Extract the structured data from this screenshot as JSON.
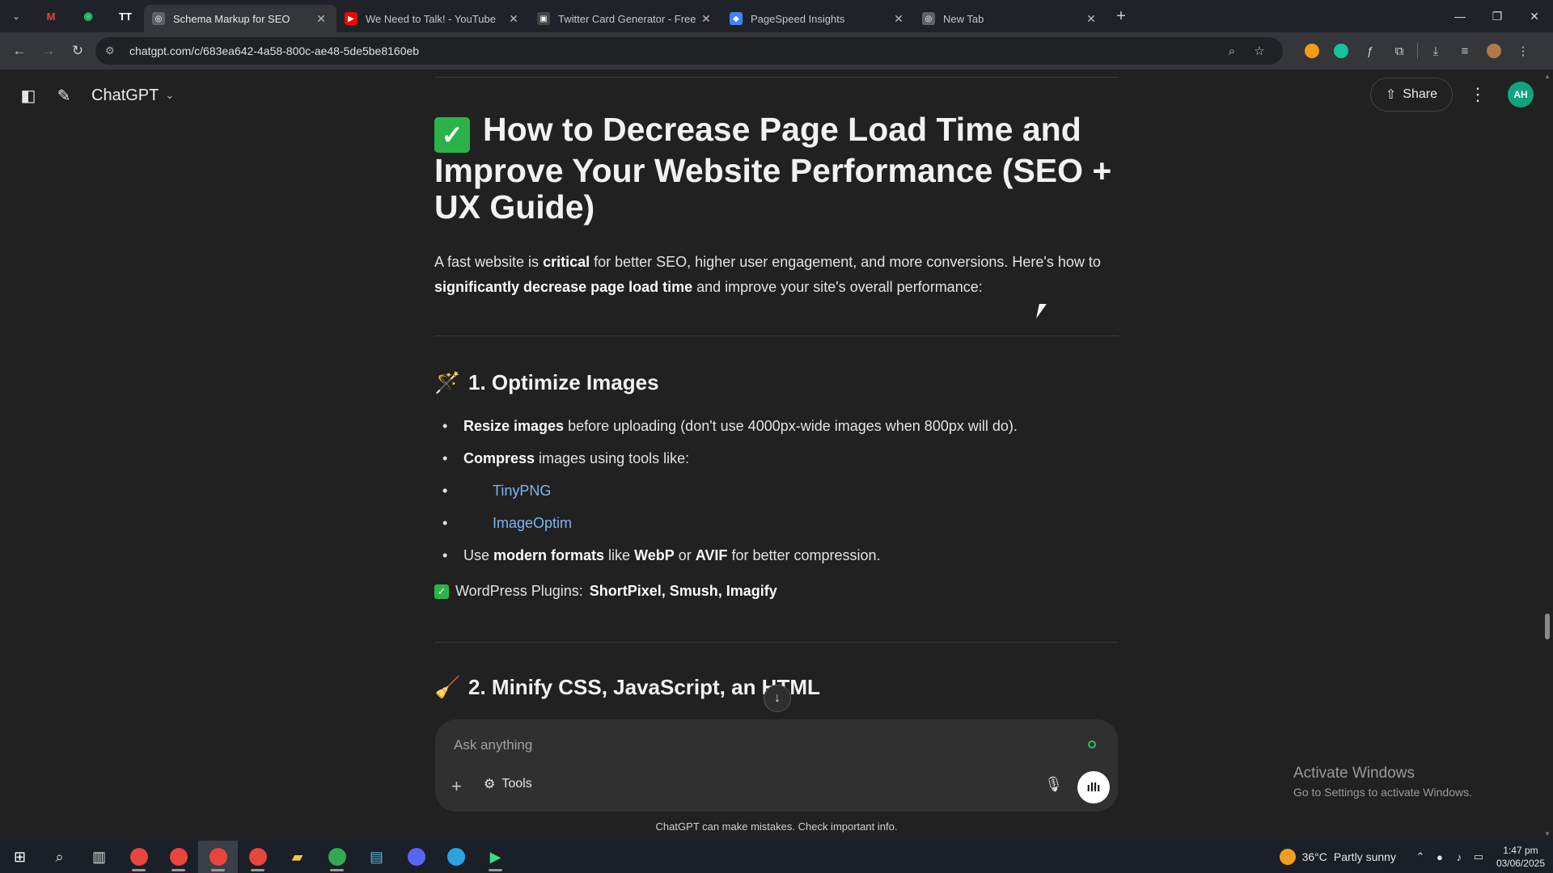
{
  "browser": {
    "pinned": [
      {
        "name": "gmail-icon",
        "glyph": "M",
        "color": "#ea4335"
      },
      {
        "name": "whatsapp-icon",
        "glyph": "◉",
        "color": "#25d366"
      },
      {
        "name": "tt-icon",
        "glyph": "TT",
        "color": "#ffffff"
      }
    ],
    "tabs": [
      {
        "title": "Schema Markup for SEO",
        "active": true,
        "fav": "◎",
        "favcolor": "#5f6368"
      },
      {
        "title": "We Need to Talk! - YouTube",
        "active": false,
        "fav": "▶",
        "favcolor": "#ff0000"
      },
      {
        "title": "Twitter Card Generator - Free T",
        "active": false,
        "fav": "▣",
        "favcolor": "#444"
      },
      {
        "title": "PageSpeed Insights",
        "active": false,
        "fav": "◆",
        "favcolor": "#4285f4"
      },
      {
        "title": "New Tab",
        "active": false,
        "fav": "◎",
        "favcolor": "#5f6368"
      }
    ],
    "url": "chatgpt.com/c/683ea642-4a58-800c-ae48-5de5be8160eb"
  },
  "app": {
    "model_label": "ChatGPT",
    "share_label": "Share",
    "avatar_initials": "AH"
  },
  "article": {
    "title": "How to Decrease Page Load Time and Improve Your Website Performance (SEO + UX Guide)",
    "intro": {
      "p1": "A fast website is ",
      "b1": "critical",
      "p2": " for better SEO, higher user engagement, and more conversions. Here's how to ",
      "b2": "significantly decrease page load time",
      "p3": " and improve your site's overall performance:"
    },
    "section1": {
      "emoji": "🪄",
      "heading": "1. Optimize Images",
      "bullet1_b": "Resize images",
      "bullet1_t": " before uploading (don't use 4000px-wide images when 800px will do).",
      "bullet2_b": "Compress",
      "bullet2_t": " images using tools like:",
      "links": [
        "TinyPNG",
        "ImageOptim"
      ],
      "bullet3_a": "Use ",
      "bullet3_b1": "modern formats",
      "bullet3_c": " like ",
      "bullet3_b2": "WebP",
      "bullet3_d": " or ",
      "bullet3_b3": "AVIF",
      "bullet3_e": " for better compression.",
      "wp_label": " WordPress Plugins: ",
      "wp_plugins": "ShortPixel, Smush, Imagify"
    },
    "section2": {
      "emoji": "🧹",
      "heading": "2. Minify CSS, JavaScript, an  HTML"
    }
  },
  "composer": {
    "placeholder": "Ask anything",
    "tools_label": "Tools",
    "disclaimer": "ChatGPT can make mistakes. Check important info."
  },
  "watermark": {
    "line1": "Activate Windows",
    "line2": "Go to Settings to activate Windows."
  },
  "taskbar": {
    "weather_temp": "36°C",
    "weather_text": "Partly sunny",
    "time": "1:47 pm",
    "date": "03/06/2025"
  }
}
